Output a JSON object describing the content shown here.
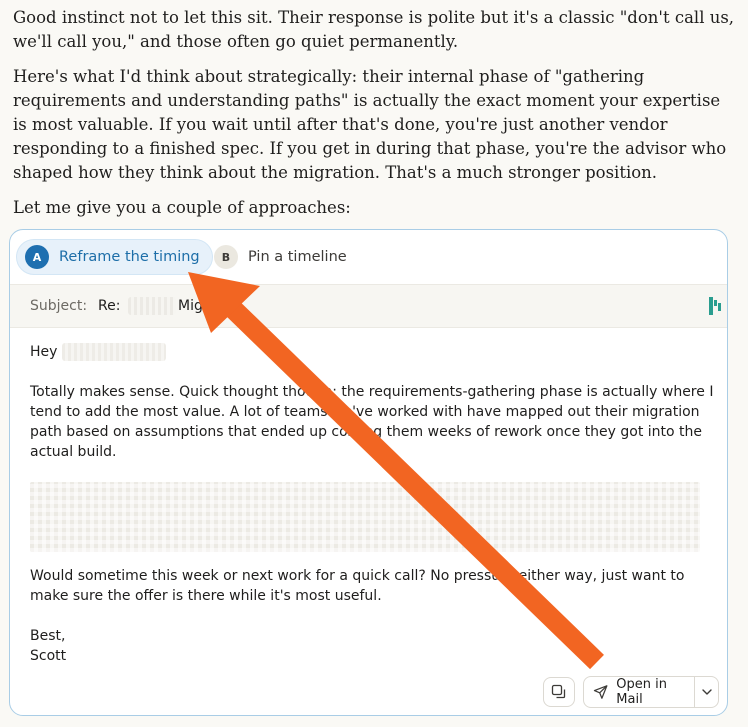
{
  "prose": {
    "p1": "Good instinct not to let this sit. Their response is polite but it's a classic \"don't call us, we'll call you,\" and those often go quiet permanently.",
    "p2": "Here's what I'd think about strategically: their internal phase of \"gathering requirements and understanding paths\" is actually the exact moment your expertise is most valuable. If you wait until after that's done, you're just another vendor responding to a finished spec. If you get in during that phase, you're the advisor who shaped how they think about the migration. That's a much stronger position.",
    "p3": "Let me give you a couple of approaches:"
  },
  "tabs": [
    {
      "badge": "A",
      "label": "Reframe the timing",
      "active": true
    },
    {
      "badge": "B",
      "label": "Pin a timeline",
      "active": false
    }
  ],
  "email": {
    "subject_label": "Subject:",
    "subject_re": "Re:",
    "subject_tail": "Mig",
    "greeting": "Hey",
    "para1": "Totally makes sense. Quick thought though: the requirements-gathering phase is actually where I tend to add the most value. A lot of teams we've worked with have mapped out their migration path based on assumptions that ended up costing them weeks of rework once they got into the actual build.",
    "para3": "Would sometime this week or next work for a quick call? No pressure either way, just want to make sure the offer is there while it's most useful.",
    "signoff": "Best,",
    "name": "Scott"
  },
  "actions": {
    "open_mail": "Open in Mail"
  },
  "colors": {
    "accent": "#1e6fb0",
    "arrow": "#f26522",
    "logo": "#2a9d8f"
  }
}
